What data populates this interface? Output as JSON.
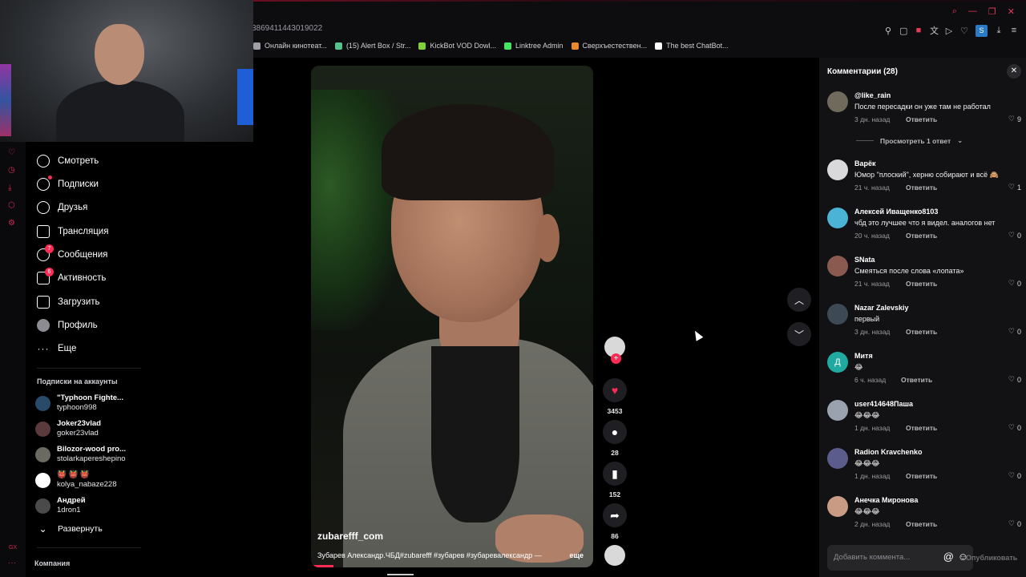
{
  "browser": {
    "url_fragment": "3869411443019022",
    "bookmarks": [
      {
        "label": "Онлайн кинотеат...",
        "color": "#9e9ea6"
      },
      {
        "label": "(15) Alert Box / Str...",
        "color": "#53c28b"
      },
      {
        "label": "KickBot VOD Dowl...",
        "color": "#7ed13b"
      },
      {
        "label": "Linktree Admin",
        "color": "#43e660"
      },
      {
        "label": "Сверхъестествен...",
        "color": "#e88a2b"
      },
      {
        "label": "The best ChatBot...",
        "color": "#ffffff"
      }
    ]
  },
  "nav": {
    "items": [
      {
        "label": "Смотреть",
        "icon": "compass-icon"
      },
      {
        "label": "Подписки",
        "icon": "following-icon"
      },
      {
        "label": "Друзья",
        "icon": "friends-icon"
      },
      {
        "label": "Трансляция",
        "icon": "live-icon"
      },
      {
        "label": "Сообщения",
        "icon": "messages-icon",
        "badge": "7"
      },
      {
        "label": "Активность",
        "icon": "activity-icon",
        "badge": "6"
      },
      {
        "label": "Загрузить",
        "icon": "upload-icon"
      },
      {
        "label": "Профиль",
        "icon": "profile-avatar"
      },
      {
        "label": "Еще",
        "icon": "more-icon"
      }
    ],
    "following_title": "Подписки на аккаунты",
    "following": [
      {
        "name": "\"Typhoon Fighte...",
        "handle": "typhoon998"
      },
      {
        "name": "Joker23vlad",
        "handle": "goker23vlad"
      },
      {
        "name": "Bilozor-wood pro...",
        "handle": "stolarkapereshepino"
      },
      {
        "name": "👹 👹 👹",
        "handle": "kolya_nabaze228"
      },
      {
        "name": "Андрей",
        "handle": "1dron1"
      }
    ],
    "expand_label": "Развернуть",
    "company_label": "Компания"
  },
  "video": {
    "author": "zubarefff_com",
    "caption": "Зубарев Александр.ЧБД#zubarefff #зубарев #зубаревалександр — ",
    "more": "еще",
    "progress": 0.08
  },
  "actions": {
    "likes": "3453",
    "comments": "28",
    "saves": "152",
    "shares": "86"
  },
  "comments": {
    "title": "Комментарии (28)",
    "view_replies": "Просмотреть 1 ответ",
    "reply_label": "Ответить",
    "items": [
      {
        "user": "@like_rain",
        "text": "После пересадки он уже там не работал",
        "time": "3 дн. назад",
        "likes": "9",
        "avatar": "#6f6a5c"
      },
      {
        "user": "Варёк",
        "text": "Юмор \"плоский\", херню собирают и всё 🙈",
        "time": "21 ч. назад",
        "likes": "1",
        "avatar": "#d9d9dc"
      },
      {
        "user": "Алексей Иващенко8103",
        "text": "чбд это лучшее что я видел. аналогов нет",
        "time": "20 ч. назад",
        "likes": "0",
        "avatar": "#4bb3d6"
      },
      {
        "user": "SNata",
        "text": "Смеяться после слова «лопата»",
        "time": "21 ч. назад",
        "likes": "0",
        "avatar": "#8a5a50"
      },
      {
        "user": "Nazar Zalevskiy",
        "text": "первый",
        "time": "3 дн. назад",
        "likes": "0",
        "avatar": "#3d4a55"
      },
      {
        "user": "Митя",
        "text": "😂",
        "time": "6 ч. назад",
        "likes": "0",
        "avatar": "#1fa9a0",
        "letter": "Д"
      },
      {
        "user": "user414648Паша",
        "text": "😂😂😂",
        "time": "1 дн. назад",
        "likes": "0",
        "avatar": "#9aa2b0"
      },
      {
        "user": "Radion Kravchenko",
        "text": "😂😂😂",
        "time": "1 дн. назад",
        "likes": "0",
        "avatar": "#5b5c8c"
      },
      {
        "user": "Анечка Миронова",
        "text": "😂😂😂",
        "time": "2 дн. назад",
        "likes": "0",
        "avatar": "#c99b84"
      }
    ],
    "input_placeholder": "Добавить коммента...",
    "publish_label": "Опубликовать"
  },
  "colors": {
    "accent": "#fe2c55",
    "panel": "#121214"
  }
}
